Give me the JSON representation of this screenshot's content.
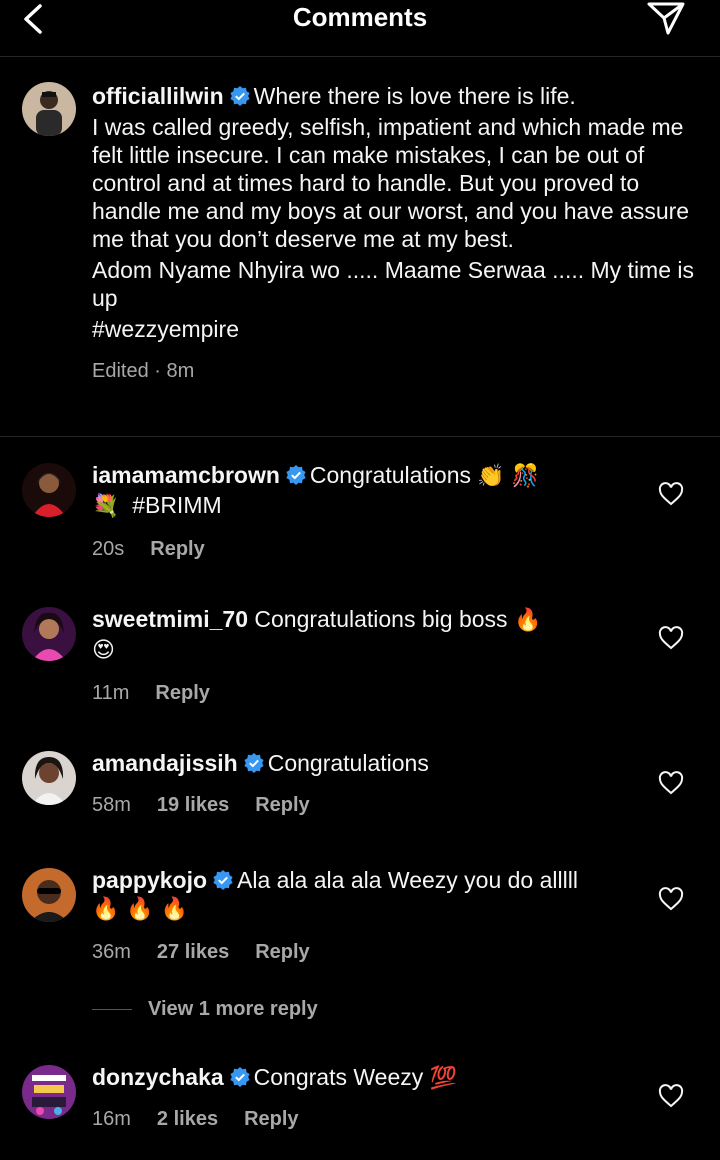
{
  "header": {
    "title": "Comments"
  },
  "caption": {
    "username": "officiallilwin",
    "first_line": "Where there is love there is life.",
    "paragraph1": "I was called greedy, selfish, impatient and which made me felt little insecure. I can make mistakes, I can be out of control and at times hard to handle. But you proved to handle me and my boys at our worst, and you have assure me that you don’t deserve me at my best.",
    "paragraph2": "Adom Nyame Nhyira wo ..... Maame Serwaa ..... My time is up",
    "hashtag": "#wezzyempire",
    "meta": "Edited · 8m"
  },
  "comments": [
    {
      "username": "iamamamcbrown",
      "verified": true,
      "text": "Congratulations",
      "emoji1": "👏 🎊",
      "line2_emoji": "💐",
      "line2_text": "#BRIMM",
      "time": "20s",
      "likes": "",
      "reply": "Reply"
    },
    {
      "username": "sweetmimi_70",
      "verified": false,
      "text": "Congratulations big boss",
      "emoji1": "🔥",
      "line2_emoji": "😍",
      "time": "11m",
      "likes": "",
      "reply": "Reply"
    },
    {
      "username": "amandajissih",
      "verified": true,
      "text": "Congratulations",
      "time": "58m",
      "likes": "19 likes",
      "reply": "Reply"
    },
    {
      "username": "pappykojo",
      "verified": true,
      "text": "Ala ala ala ala Weezy you do alllll",
      "line2_emoji": "🔥 🔥 🔥",
      "time": "36m",
      "likes": "27 likes",
      "reply": "Reply"
    },
    {
      "username": "donzychaka",
      "verified": true,
      "text": "Congrats Weezy",
      "emoji1": "💯",
      "time": "16m",
      "likes": "2 likes",
      "reply": "Reply"
    }
  ],
  "view_more": "View 1 more reply",
  "colors": {
    "background": "#000000",
    "text": "#f5f5f5",
    "muted": "#a8a8a8",
    "verified": "#3897f0"
  },
  "icons": {
    "back": "chevron-left-icon",
    "share": "paper-plane-icon",
    "like": "heart-outline-icon",
    "verified": "verified-badge-icon"
  }
}
